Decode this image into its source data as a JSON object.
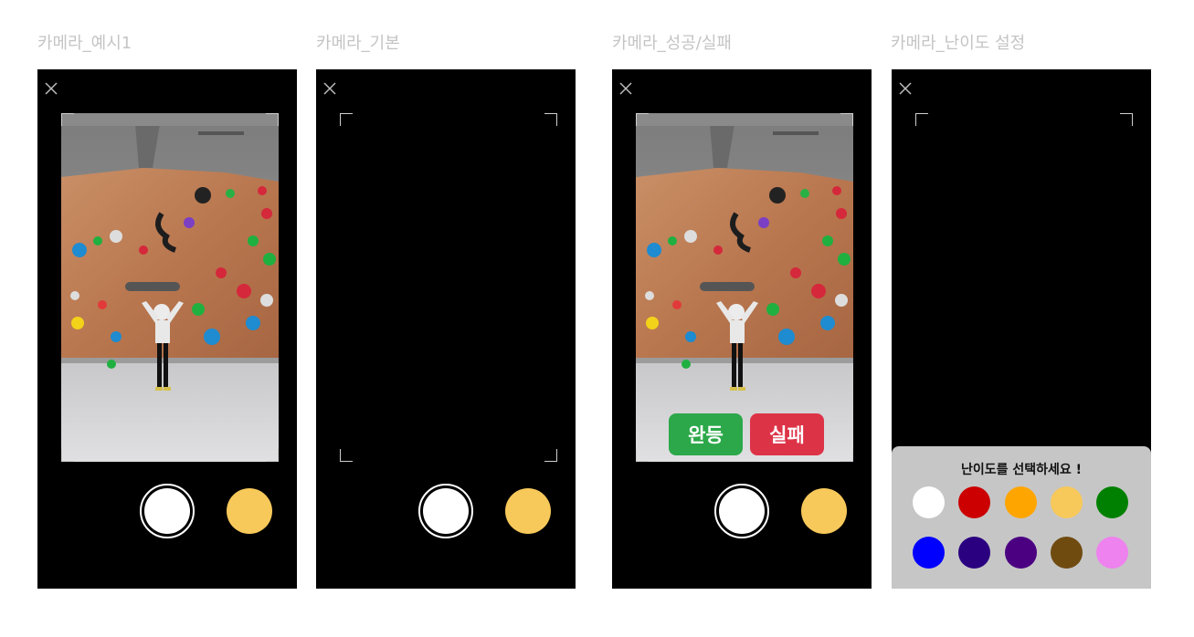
{
  "frames": [
    {
      "title": "카메라_예시1",
      "close_icon": "close-icon",
      "has_photo": true,
      "level_color": "#f7c95a"
    },
    {
      "title": "카메라_기본",
      "close_icon": "close-icon",
      "has_photo": false,
      "level_color": "#f7c95a"
    },
    {
      "title": "카메라_성공/실패",
      "close_icon": "close-icon",
      "has_photo": true,
      "level_color": "#f7c95a",
      "success_label": "완등",
      "fail_label": "실패",
      "success_color": "#2ca84a",
      "fail_color": "#dd3347"
    },
    {
      "title": "카메라_난이도 설정",
      "close_icon": "close-icon",
      "has_photo": false,
      "panel_title": "난이도를 선택하세요 !",
      "difficulty_colors": [
        "#ffffff",
        "#cc0000",
        "#ffa500",
        "#f7c95a",
        "#008000",
        "#0000ff",
        "#2a0080",
        "#4b0082",
        "#704b10",
        "#ee82ee"
      ]
    }
  ]
}
